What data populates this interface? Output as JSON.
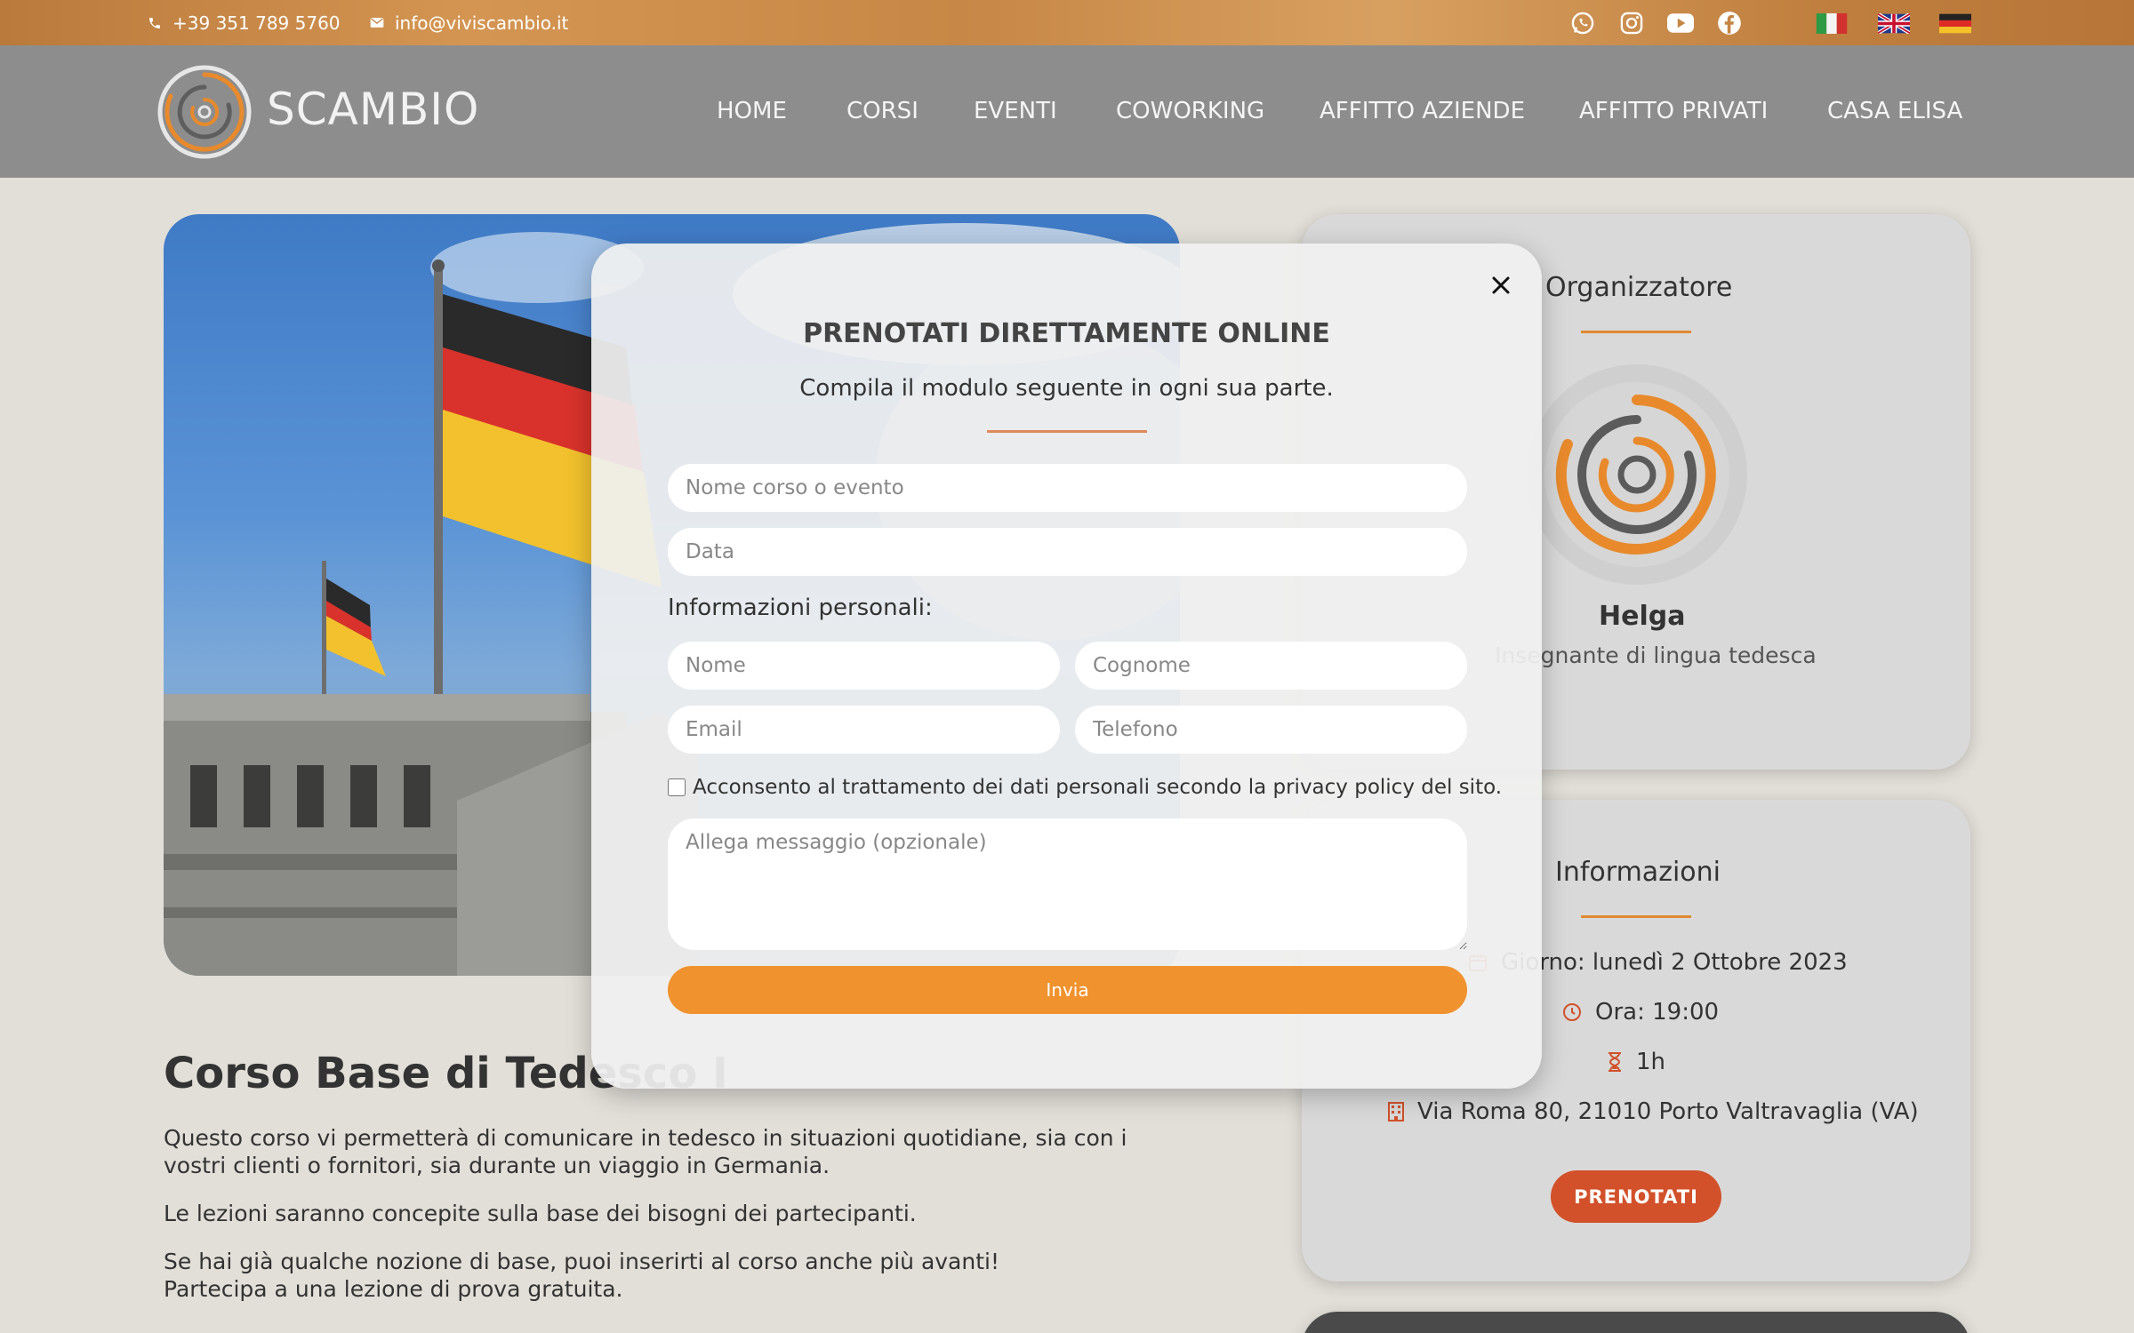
{
  "topbar": {
    "phone": "+39 351 789 5760",
    "email": "info@viviscambio.it",
    "social_icons": [
      "whatsapp-icon",
      "instagram-icon",
      "youtube-icon",
      "facebook-icon"
    ],
    "languages": [
      "italian-flag",
      "english-flag",
      "german-flag"
    ]
  },
  "header": {
    "brand": "SCAMBIO",
    "nav": [
      "HOME",
      "CORSI",
      "EVENTI",
      "COWORKING",
      "AFFITTO AZIENDE",
      "AFFITTO PRIVATI",
      "CASA ELISA"
    ]
  },
  "organizer": {
    "title": "Organizzatore",
    "name": "Helga",
    "role": "Insegnante di lingua tedesca"
  },
  "info": {
    "title": "Informazioni",
    "date": "Giorno: lunedì 2 Ottobre 2023",
    "time": "Ora: 19:00",
    "duration": "1h",
    "address": "Via Roma 80, 21010 Porto Valtravaglia (VA)",
    "book_label": "PRENOTATI"
  },
  "course": {
    "title": "Corso Base di Tedesco I",
    "paragraphs": [
      "Questo corso vi permetterà di comunicare in tedesco in situazioni quotidiane, sia con i vostri clienti o fornitori, sia durante un viaggio in Germania.",
      "Le lezioni saranno concepite sulla base dei bisogni dei partecipanti.",
      "Se hai già qualche nozione di base, puoi inserirti al corso anche più avanti!",
      "Partecipa a una lezione di prova gratuita."
    ]
  },
  "modal": {
    "title": "PRENOTATI DIRETTAMENTE ONLINE",
    "subtitle": "Compila il modulo seguente in ogni sua parte.",
    "course_placeholder": "Nome corso o evento",
    "date_placeholder": "Data",
    "personal_label": "Informazioni personali:",
    "name_placeholder": "Nome",
    "surname_placeholder": "Cognome",
    "email_placeholder": "Email",
    "phone_placeholder": "Telefono",
    "consent": "Acconsento al trattamento dei dati personali secondo la privacy policy del sito.",
    "message_placeholder": "Allega messaggio (opzionale)",
    "send_label": "Invia"
  },
  "colors": {
    "accent": "#f0922d",
    "button": "#d2512a",
    "header": "#8d8d8d"
  }
}
